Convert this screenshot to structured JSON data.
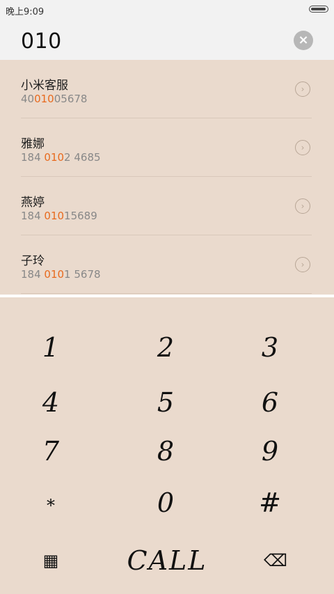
{
  "status_bar": {
    "time": "晚上9:09"
  },
  "input": {
    "number": "010"
  },
  "results": [
    {
      "name": "小米客服",
      "number_parts": [
        "40",
        "010",
        "05678"
      ]
    },
    {
      "name": "雅娜",
      "number_parts": [
        "184 ",
        "010",
        "2 4685"
      ]
    },
    {
      "name": "燕婷",
      "number_parts": [
        "184 ",
        "010",
        "15689"
      ]
    },
    {
      "name": "子玲",
      "number_parts": [
        "184 ",
        "010",
        "1 5678"
      ]
    }
  ],
  "keypad": {
    "keys": [
      "1",
      "2",
      "3",
      "4",
      "5",
      "6",
      "7",
      "8",
      "9",
      "*",
      "0",
      "#"
    ],
    "call_label": "CALL"
  },
  "colors": {
    "accent": "#e86a1e",
    "background": "#ead8cb"
  },
  "icons": {
    "clear": "clear-x-icon",
    "arrow": "chevron-right-icon",
    "keypad": "keypad-grid-icon",
    "backspace": "backspace-icon"
  }
}
